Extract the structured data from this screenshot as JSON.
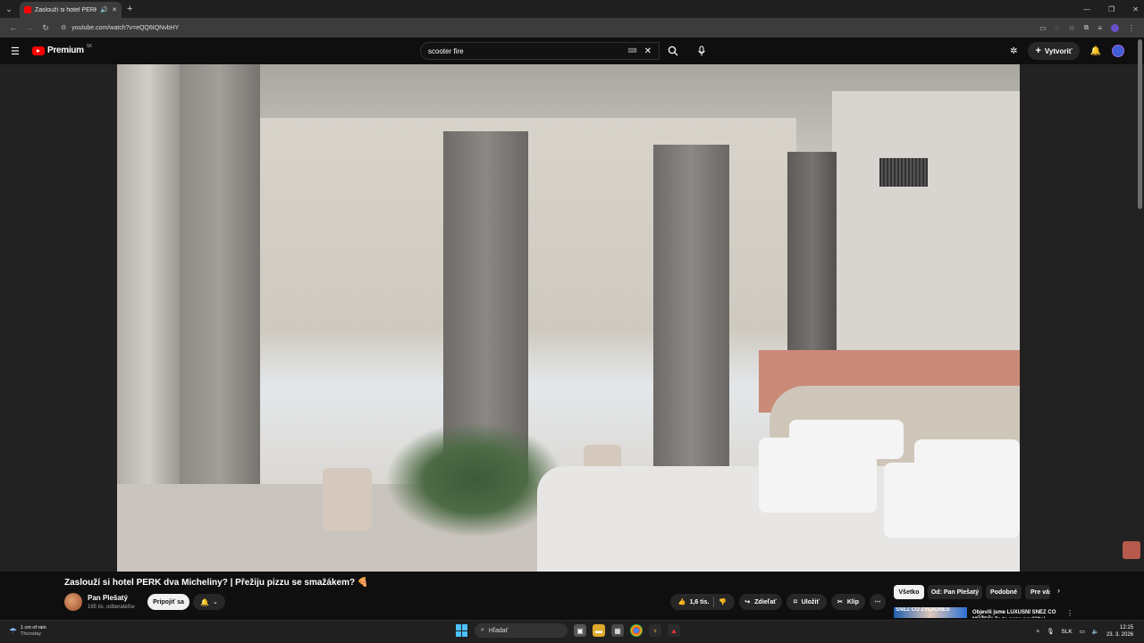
{
  "browser": {
    "tab_title": "Zaslouží si hotel PERK dva Micheliny? | Přežiju pizzu se smažákem?",
    "url": "youtube.com/watch?v=eQQ6tQNvbHY"
  },
  "header": {
    "logo_text": "Premium",
    "logo_country": "SK",
    "search_value": "scooter fire",
    "create_label": "Vytvoriť"
  },
  "video": {
    "title": "Zaslouží si hotel PERK dva Micheliny? | Přežiju pizzu se smažákem? 🍕",
    "channel_name": "Pan Plešatý",
    "channel_subs": "165 tis. odberateľov",
    "join_label": "Pripojiť sa",
    "like_count": "1,6 tis.",
    "share_label": "Zdieľať",
    "save_label": "Uložiť",
    "clip_label": "Klip"
  },
  "chips": [
    "Všetko",
    "Od: Pan Plešatý",
    "Podobné",
    "Pre vás"
  ],
  "recommendation": {
    "thumb_text": "SNĚZ CO ZVLÁDNEŠ",
    "title": "Objevili jsme LUXUSNÍ SNĚZ CO MŮŽEŠ! Za to cenu nevěříte!"
  },
  "taskbar": {
    "weather_line1": "1 cm of rain",
    "weather_line2": "Thursday",
    "search_label": "Hľadať",
    "lang": "SLK",
    "time": "12:15",
    "date": "23. 3. 2026"
  },
  "colors": {
    "accent_red": "#ff0000",
    "bg": "#0f0f0f"
  }
}
